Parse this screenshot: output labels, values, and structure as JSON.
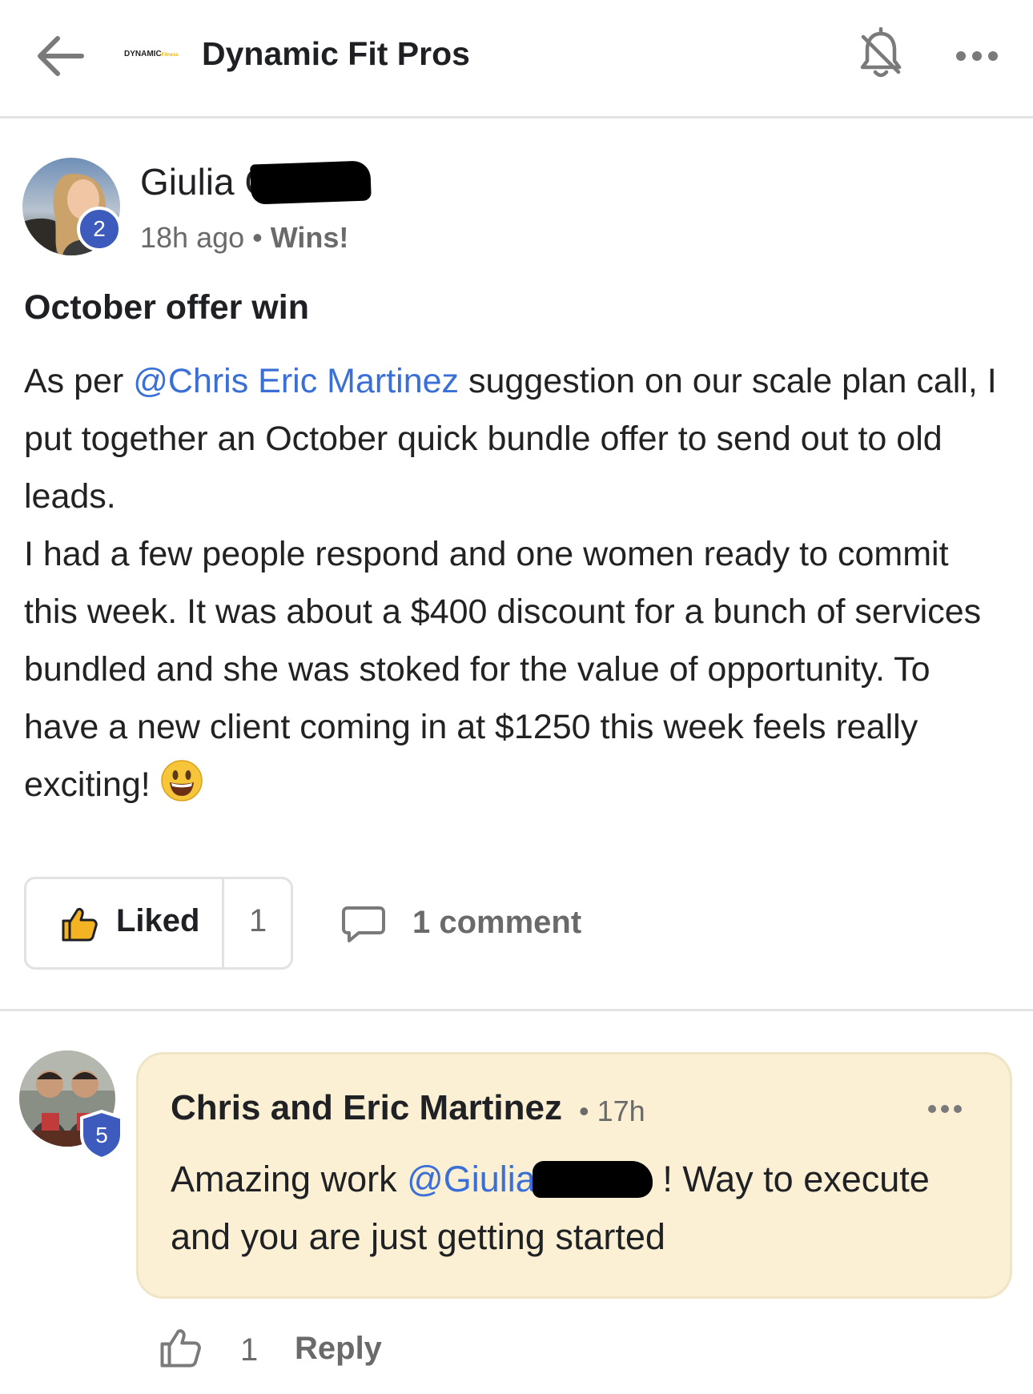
{
  "header": {
    "logo_text": "DYNAMIC",
    "logo_sub": "Fitness",
    "title": "Dynamic Fit Pros",
    "icons": [
      "back-arrow-icon",
      "bell-off-icon",
      "more-horizontal-icon"
    ]
  },
  "post": {
    "author": "Giulia C",
    "level_badge": "2",
    "time": "18h ago",
    "category": "Wins!",
    "title": "October offer win",
    "body_p1_pre": "As per ",
    "body_p1_mention": "@Chris Eric Martinez",
    "body_p1_post": " suggestion on our scale plan call, I put together an October quick bundle offer to send out to old leads.",
    "body_p2": "I had a few people respond and one women ready to commit this week. It was about a $400 discount for a bunch of services bundled and she was stoked for the value of opportunity. To have a new client coming in at $1250 this week feels really exciting!",
    "liked_label": "Liked",
    "like_count": "1",
    "comment_label": "1 comment"
  },
  "comment": {
    "author": "Chris and Eric Martinez",
    "time": "17h",
    "level_badge": "5",
    "body_pre": "Amazing work ",
    "body_mention": "@Giulia",
    "body_post": " ! Way to execute and you are just getting started",
    "like_count": "1",
    "reply_label": "Reply"
  },
  "colors": {
    "mention": "#3a6fd8",
    "badge_blue": "#3d5bbd",
    "comment_bg": "#fbf0d4"
  }
}
